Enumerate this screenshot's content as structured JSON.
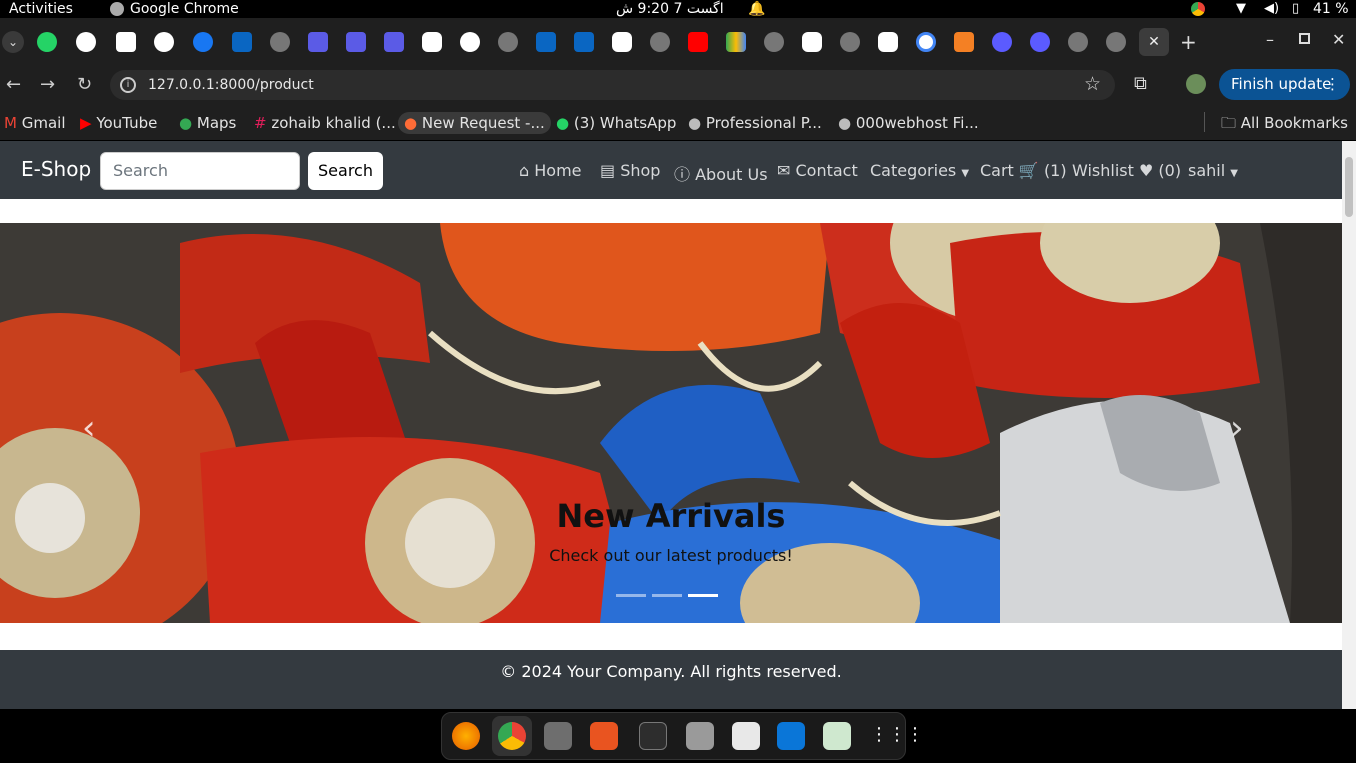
{
  "system_bar": {
    "activities": "Activities",
    "app_name": "Google Chrome",
    "clock": "اگست 7  9:20 ش",
    "battery": "41 %"
  },
  "browser": {
    "url": "127.0.0.1:8000/product",
    "finish_update": "Finish update",
    "bookmarks": [
      "Gmail",
      "YouTube",
      "Maps",
      "zohaib khalid (...",
      "New Request -...",
      "(3) WhatsApp",
      "Professional P...",
      "000webhost Fi..."
    ],
    "all_bookmarks": "All Bookmarks"
  },
  "nav": {
    "brand": "E-Shop",
    "search_placeholder": "Search",
    "search_button": "Search",
    "home": "Home",
    "shop": "Shop",
    "about": "About Us",
    "contact": "Contact",
    "categories": "Categories",
    "cart": "Cart",
    "cart_count": "(1)",
    "wishlist": "Wishlist",
    "wishlist_count": "(0)",
    "user": "sahil"
  },
  "carousel": {
    "title": "New Arrivals",
    "caption": "Check out our latest products!",
    "active_slide": 3,
    "slide_count": 3
  },
  "footer": {
    "text": "© 2024 Your Company. All rights reserved."
  }
}
